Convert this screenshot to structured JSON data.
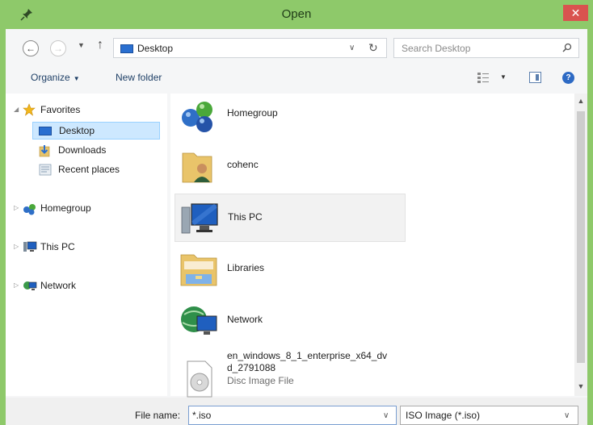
{
  "window": {
    "title": "Open",
    "close_glyph": "✕"
  },
  "address_bar": {
    "path": "Desktop",
    "back_glyph": "←",
    "forward_glyph": "→",
    "up_glyph": "↑",
    "caret_glyph": "∨",
    "refresh_glyph": "↻"
  },
  "search": {
    "placeholder": "Search Desktop"
  },
  "toolbar": {
    "organize_label": "Organize",
    "new_folder_label": "New folder",
    "help_glyph": "?"
  },
  "nav_pane": {
    "favorites": {
      "label": "Favorites",
      "items": [
        {
          "label": "Desktop",
          "icon": "desktop-icon",
          "selected": true
        },
        {
          "label": "Downloads",
          "icon": "downloads-icon"
        },
        {
          "label": "Recent places",
          "icon": "recent-places-icon"
        }
      ]
    },
    "roots": [
      {
        "label": "Homegroup",
        "icon": "homegroup-icon"
      },
      {
        "label": "This PC",
        "icon": "computer-icon"
      },
      {
        "label": "Network",
        "icon": "network-icon"
      }
    ]
  },
  "files": [
    {
      "name": "Homegroup",
      "icon": "homegroup-icon"
    },
    {
      "name": "cohenc",
      "icon": "user-folder-icon"
    },
    {
      "name": "This PC",
      "icon": "computer-icon",
      "hovered": true
    },
    {
      "name": "Libraries",
      "icon": "libraries-icon"
    },
    {
      "name": "Network",
      "icon": "network-icon"
    },
    {
      "name_line1": "en_windows_8_1_enterprise_x64_dv",
      "name_line2": "d_2791088",
      "type": "Disc Image File",
      "icon": "disc-image-icon"
    }
  ],
  "bottom_bar": {
    "file_name_label": "File name:",
    "file_name_value": "*.iso",
    "file_type_value": "ISO Image (*.iso)"
  },
  "colors": {
    "titlebar": "#8ec96a",
    "selection": "#cde8ff",
    "close": "#d9534f"
  }
}
